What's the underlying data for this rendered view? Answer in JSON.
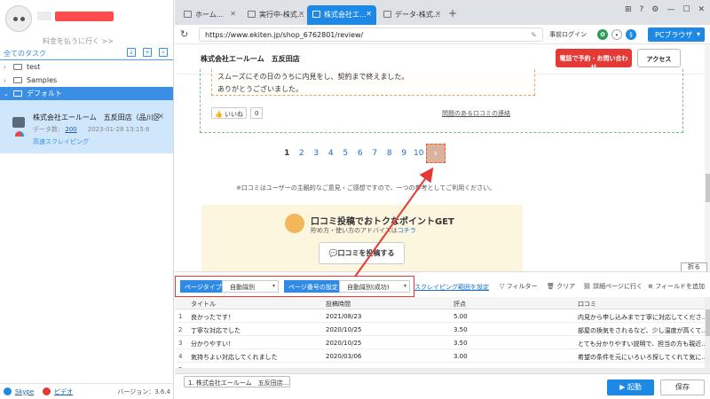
{
  "sidebar": {
    "upgrade_text": "料金を払うに行く >>",
    "title": "全てのタスク",
    "tree": [
      {
        "label": "test"
      },
      {
        "label": "Samples"
      },
      {
        "label": "デフォルト"
      }
    ],
    "task": {
      "name": "株式会社エールーム　五反田店（品川区東...",
      "data_label": "データ数:",
      "data_count": "200",
      "date": "2023-01-28 13:15:8",
      "mode": "高速スクレイピング"
    },
    "footer": {
      "skype": "Skype",
      "video": "ビデオ",
      "version": "バージョン：3.6.4"
    }
  },
  "browser": {
    "tabs": [
      {
        "label": "ホーム..."
      },
      {
        "label": "実行中-株式..."
      },
      {
        "label": "株式会社エ..."
      },
      {
        "label": "データ-株式..."
      }
    ],
    "url": "https://www.ekiten.jp/shop_6762801/review/",
    "prelogin": "事前ログイン",
    "pc_browser": "PCブラウザ"
  },
  "page": {
    "store": "株式会社エールーム　五反田店",
    "call_btn": "電話で予約・お問い合わせ",
    "access_btn": "アクセス",
    "review_lines": [
      "スムーズにその日のうちに内見をし、契約まで終えました。",
      "ありがとうございました。"
    ],
    "like_label": "いいね",
    "like_count": "0",
    "report": "問題のある口コミの連絡",
    "pages": [
      "1",
      "2",
      "3",
      "4",
      "5",
      "6",
      "7",
      "8",
      "9",
      "10"
    ],
    "next": "›",
    "notice": "※口コミはユーザーの主観的なご意見・ご感想ですので、一つの参考としてご利用ください。",
    "promo_title": "口コミ投稿でおトクなポイントGET",
    "promo_sub_a": "貯め方・使い方のアドバイスは",
    "promo_sub_link": "コチラ",
    "post_btn": "💬口コミを投稿する",
    "collapse": "折る"
  },
  "config": {
    "page_type_label": "ページタイプ",
    "page_type_value": "自動識別",
    "page_num_label": "ページ番号の設定",
    "page_num_value": "自動識別(成功)",
    "scope_link": "スクレイピング範囲を設定",
    "filter": "フィルター",
    "clear": "クリア",
    "detail": "詳細ページに行く",
    "add_field": "フィールドを追加"
  },
  "table": {
    "columns": [
      "タイトル",
      "投稿時間",
      "評点",
      "口コミ"
    ],
    "rows": [
      {
        "idx": "1",
        "title": "良かったです！",
        "time": "2021/08/23",
        "score": "5.00",
        "review": "内見から申し込みまで丁寧に対応してくださ..."
      },
      {
        "idx": "2",
        "title": "丁寧な対応でした",
        "time": "2020/10/25",
        "score": "3.50",
        "review": "部屋の換気をされるなど、少し温度が高くて..."
      },
      {
        "idx": "3",
        "title": "分かりやすい！",
        "time": "2020/10/25",
        "score": "3.50",
        "review": "とても分かりやすい説明で、担当の方も親近..."
      },
      {
        "idx": "4",
        "title": "気持ちよい対応してくれました",
        "time": "2020/03/06",
        "score": "3.00",
        "review": "希望の条件を元にいろいろ探してくれて気に..."
      },
      {
        "idx": "5",
        "title": "",
        "time": "",
        "score": "",
        "review": ""
      }
    ]
  },
  "bottom": {
    "task_tab": "1. 株式会社エールーム　五反田店...",
    "start": "▶ 起動",
    "save": "保存"
  }
}
